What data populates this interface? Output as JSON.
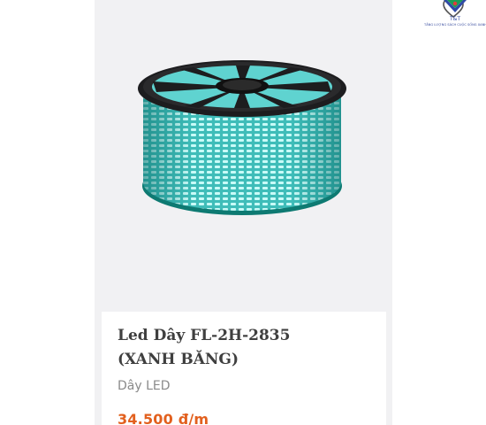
{
  "product": {
    "name": "Led Dây FL-2H-2835 (XANH BĂNG)",
    "category": "Dây LED",
    "price": "34.500 đ/m",
    "image": "led-strip-reel-ice-blue",
    "accent_color": "#e2601e",
    "strip_color": "#5fd3d0"
  },
  "icons": {
    "wishlist": "heart-outline-icon"
  },
  "brand": {
    "logo_text": "T&T",
    "logo_tagline": "TĂNG LƯỢNG SÁCH CUỘC SỐNG XANH"
  }
}
